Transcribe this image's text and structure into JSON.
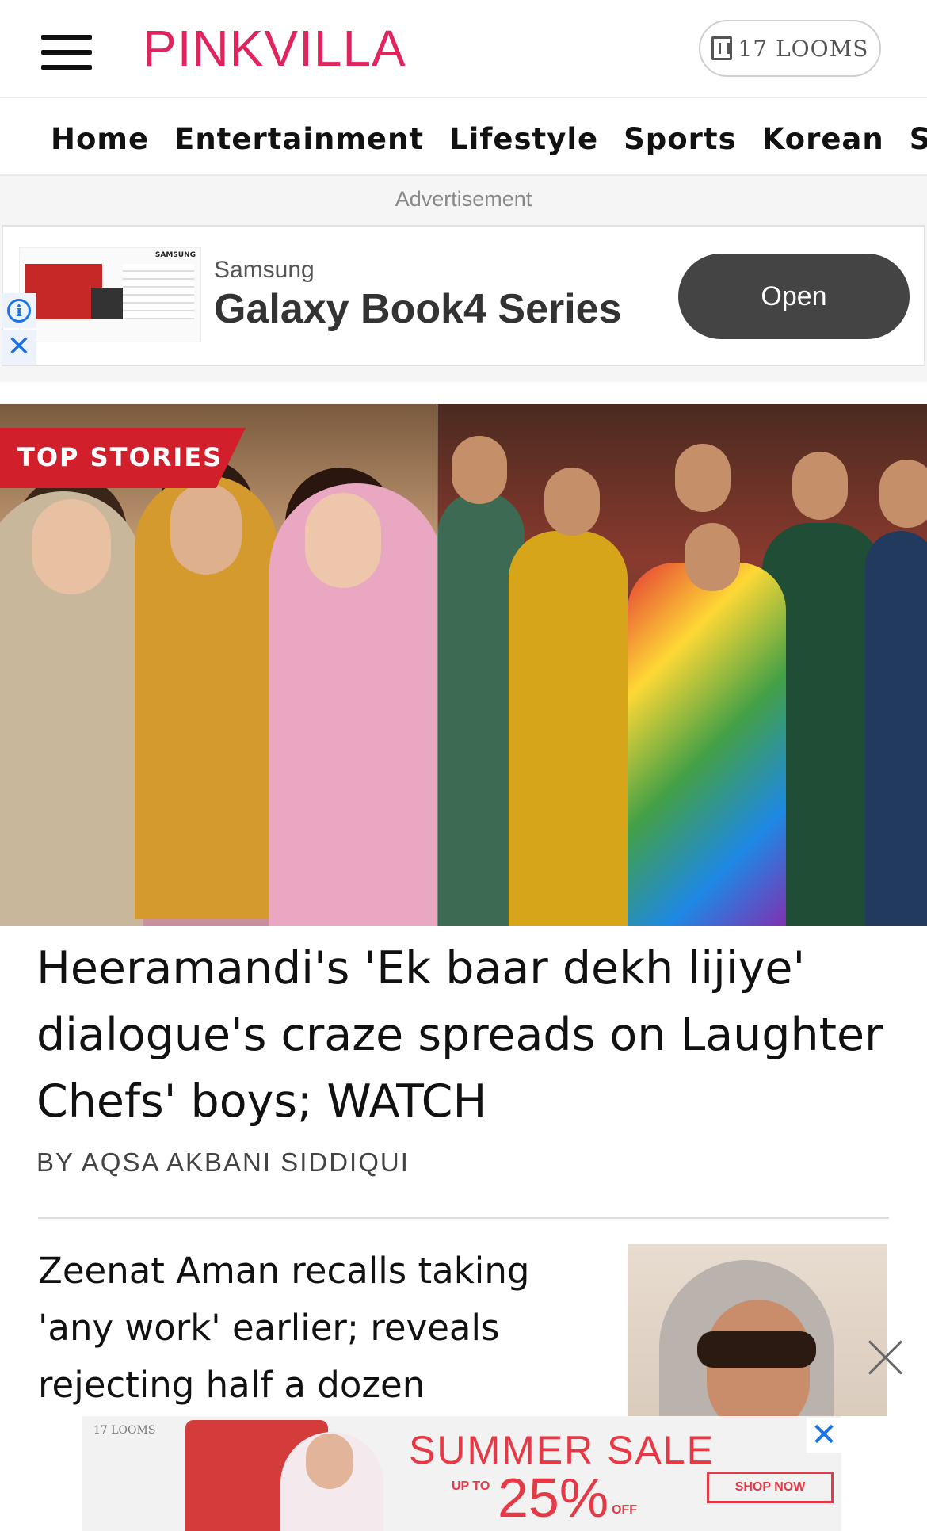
{
  "header": {
    "logo": "PINKVILLA",
    "looms_label": "17 LOOMS"
  },
  "nav": {
    "items": [
      "Home",
      "Entertainment",
      "Lifestyle",
      "Sports",
      "Korean",
      "Sele"
    ]
  },
  "ad": {
    "label": "Advertisement",
    "brand": "Samsung",
    "title": "Galaxy Book4 Series",
    "button": "Open",
    "thumb_brand": "SAMSUNG"
  },
  "hero": {
    "tag": "TOP STORIES"
  },
  "story": {
    "title": "Heeramandi's 'Ek baar dekh lijiye' dialogue's craze spreads on Laughter Chefs' boys; WATCH",
    "author": "BY AQSA AKBANI SIDDIQUI"
  },
  "story2": {
    "title": "Zeenat Aman recalls taking 'any work' earlier; reveals rejecting half a dozen"
  },
  "bottom_ad": {
    "brand": "17 LOOMS",
    "sale": "SUMMER SALE",
    "upto": "UP TO",
    "percent": "25%",
    "off": "OFF",
    "shop": "SHOP NOW"
  }
}
